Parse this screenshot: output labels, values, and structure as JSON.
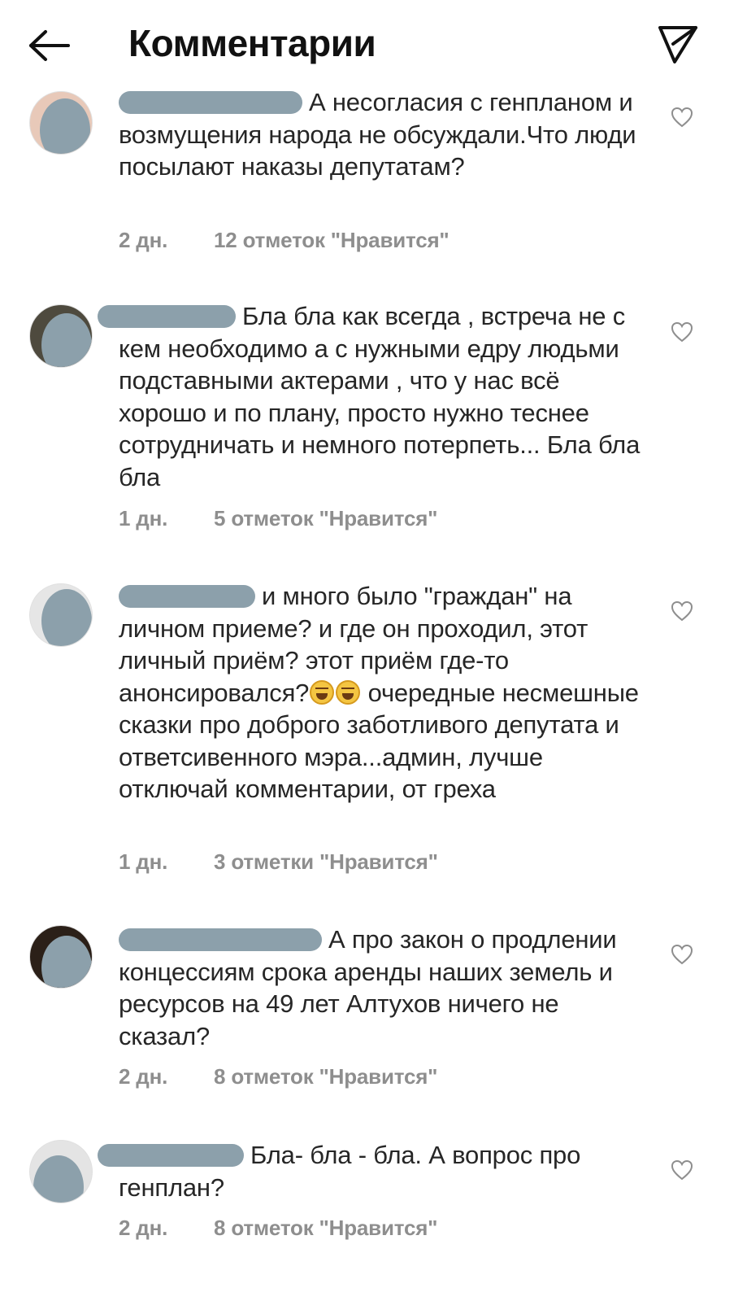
{
  "header": {
    "title": "Комментарии",
    "back_icon": "arrow-left-icon",
    "share_icon": "send-icon"
  },
  "comments": [
    {
      "text": "А несогласия с генпланом и возмущения народа не обсуждали.Что люди посылают наказы депутатам?",
      "age": "2 дн.",
      "likes": "12 отметок \"Нравится\""
    },
    {
      "text": "Бла бла как всегда , встреча не с кем необходимо а с нужными едру людьми подставными актерами , что у нас всё хорошо и по плану, просто нужно теснее сотрудничать и немного потерпеть... Бла бла бла",
      "age": "1 дн.",
      "likes": "5 отметок \"Нравится\""
    },
    {
      "text_before_emoji": "и много было \"граждан\" на личном приеме? и где он проходил, этот личный приём? этот приём где-то анонсировался?",
      "text_after_emoji": " очередные несмешные сказки про доброго заботливого  депутата и ответсивенного мэра...админ, лучше отключай комментарии, от греха",
      "emoji": "😂😂",
      "age": "1 дн.",
      "likes": "3 отметки \"Нравится\""
    },
    {
      "text": "А про закон о продлении концессиям срока аренды наших земель и ресурсов на 49 лет Алтухов ничего не сказал?",
      "age": "2 дн.",
      "likes": "8 отметок \"Нравится\""
    },
    {
      "text": "Бла- бла - бла. А вопрос про генплан?",
      "age": "2 дн.",
      "likes": "8 отметок \"Нравится\""
    }
  ],
  "colors": {
    "text": "#262626",
    "meta": "#8e8e8e",
    "mask": "#8ca0ab"
  }
}
